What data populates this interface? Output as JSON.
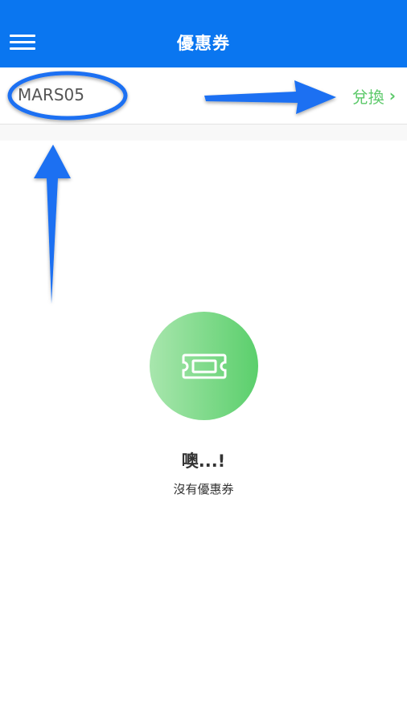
{
  "navbar": {
    "title": "優惠券",
    "menu_icon": "hamburger-menu-icon",
    "background": "#0a76f0"
  },
  "coupon_entry": {
    "code_value": "MARS05",
    "redeem_label": "兌換",
    "redeem_icon": "chevron-right-icon",
    "accent": "#5cc96a"
  },
  "empty_state": {
    "icon": "ticket-icon",
    "title": "噢...!",
    "message": "沒有優惠券"
  },
  "annotations": {
    "color": "#1a6ff2",
    "items": [
      "circle-around-code",
      "arrow-up-to-code",
      "arrow-right-to-redeem"
    ]
  }
}
